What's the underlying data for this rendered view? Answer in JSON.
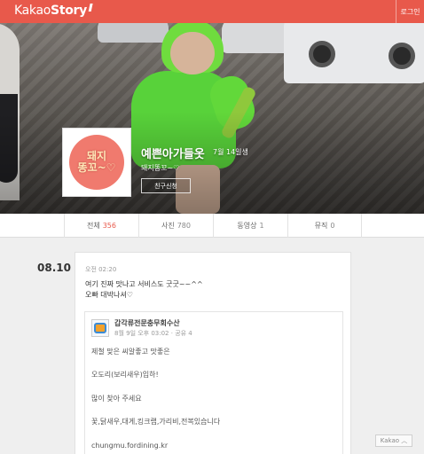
{
  "header": {
    "logo_regular": "Kakao",
    "logo_bold": "Story",
    "login_label": "로그인"
  },
  "profile": {
    "avatar_text_line1": "돼지",
    "avatar_text_line2": "똥꼬~♡",
    "name": "예쁜아가들옷",
    "birthday": "7월 14일생",
    "status": "돼지똥꼬~♡",
    "friend_button": "친구신청"
  },
  "tabs": [
    {
      "label": "전체",
      "count": "356"
    },
    {
      "label": "사진",
      "count": "780"
    },
    {
      "label": "동영상",
      "count": "1"
    },
    {
      "label": "뮤직",
      "count": "0"
    }
  ],
  "feed": {
    "date": "08.10",
    "post": {
      "time": "오전 02:20",
      "text": "여기 진짜 맛나고 서비스도 굿굿~~^^\n오빠 대박나셔♡",
      "shared": {
        "title": "갑각류전문충무회수산",
        "meta": "8월 9일 오후 03:02 · 공유 4",
        "body": "제철 맞은 씨알좋고 맛좋은\n\n오도리(보리새우)입하!\n\n많이 찾아 주세요\n\n꽃,닭새우,대게,킹크랩,가리비,전복있습니다\n\nchungmu.fordining.kr"
      }
    }
  },
  "footer": {
    "kakao_label": "Kakao ︿"
  },
  "colors": {
    "brand": "#e8594b",
    "accent_count": "#e8594b"
  }
}
